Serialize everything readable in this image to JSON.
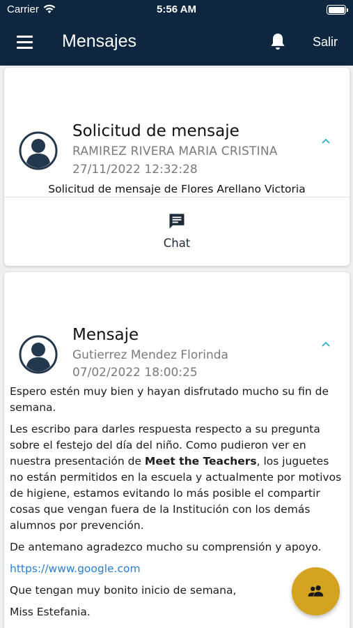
{
  "status_bar": {
    "carrier": "Carrier",
    "time": "5:56 AM"
  },
  "header": {
    "title": "Mensajes",
    "logout_label": "Salir"
  },
  "messages": [
    {
      "title": "Solicitud de mensaje",
      "sender": "RAMIREZ RIVERA MARIA CRISTINA",
      "date": "27/11/2022 12:32:28",
      "description": "Solicitud de mensaje de Flores Arellano Victoria",
      "action_label": "Chat"
    },
    {
      "title": "Mensaje",
      "sender": "Gutierrez Mendez Florinda",
      "date": "07/02/2022 18:00:25",
      "paragraphs": {
        "p1": "Espero estén muy bien y hayan disfrutado mucho su fin de semana.",
        "p2_before": "Les escribo para darles respuesta respecto a su pregunta sobre el festejo del día del niño. Como pudieron ver en nuestra presentación de ",
        "p2_bold": "Meet the Teachers",
        "p2_after": ", los juguetes no están permitidos en la escuela y actualmente por motivos de higiene, estamos evitando lo más posible el compartir cosas que vengan fuera de la Institución con los demás alumnos por prevención.",
        "p3": "De antemano agradezco mucho su comprensión y apoyo.",
        "link": "https://www.google.com",
        "p4": "Que tengan muy bonito inicio de semana,",
        "p5": "Miss Estefania."
      }
    }
  ],
  "icons": {
    "menu": "menu-icon",
    "bell": "bell-icon",
    "avatar": "avatar-icon",
    "chevron": "chevron-up-icon",
    "chat": "chat-icon",
    "fab": "group-icon"
  },
  "colors": {
    "header_bg": "#0e2640",
    "accent_chevron": "#3fb3c8",
    "fab_bg": "#d4a31f",
    "link": "#2a7fd0"
  }
}
